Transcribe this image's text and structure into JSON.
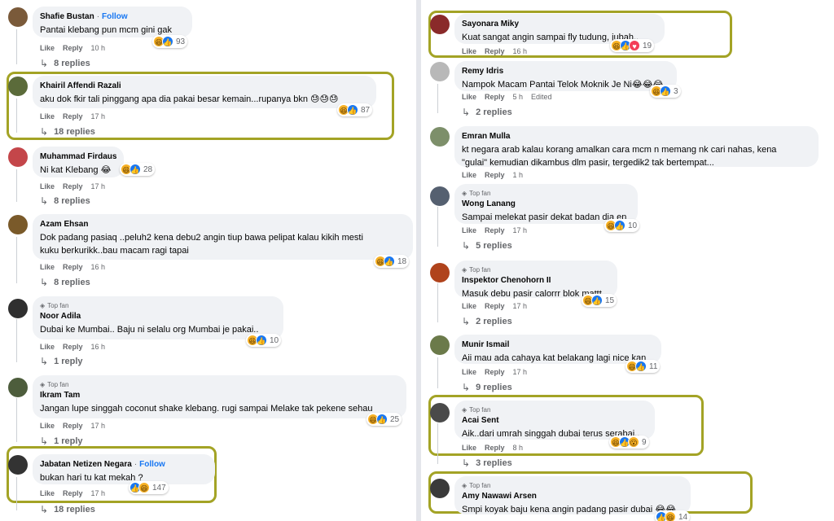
{
  "ui": {
    "like_label": "Like",
    "reply_label": "Reply",
    "top_fan_label": "Top fan",
    "follow_label": "Follow",
    "dot": "·",
    "reply_arrow": "↳",
    "diamond": "◈"
  },
  "highlight_color": "#a3a325",
  "left_comments": [
    {
      "name": "Shafie Bustan",
      "follow": true,
      "text": "Pantai klebang pun mcm gini gak",
      "time": "10 h",
      "reactions": [
        "haha",
        "like"
      ],
      "count": "93",
      "replies": "8 replies"
    },
    {
      "name": "Khairil Affendi Razali",
      "text": "aku dok fkir tali pinggang apa dia pakai besar kemain...rupanya bkn 😓😓😓",
      "time": "17 h",
      "reactions": [
        "haha",
        "like"
      ],
      "count": "87",
      "replies": "18 replies"
    },
    {
      "name": "Muhammad Firdaus",
      "text": "Ni kat Klebang 😂",
      "time": "17 h",
      "reactions": [
        "haha",
        "like"
      ],
      "count": "28",
      "replies": "8 replies"
    },
    {
      "name": "Azam Ehsan",
      "text": "Dok padang pasiaq ..peluh2 kena debu2 angin tiup bawa pelipat kalau kikih mesti",
      "text2": "kuku berkurikk..bau macam ragi tapai",
      "time": "16 h",
      "reactions": [
        "haha",
        "like"
      ],
      "count": "18",
      "replies": "8 replies"
    },
    {
      "name": "Noor Adila",
      "topfan": true,
      "text": "Dubai ke Mumbai.. Baju ni selalu org Mumbai je pakai..",
      "time": "16 h",
      "reactions": [
        "haha",
        "like"
      ],
      "count": "10",
      "replies": "1 reply"
    },
    {
      "name": "Ikram Tam",
      "topfan": true,
      "text": "Jangan lupe singgah coconut shake klebang. rugi sampai Melake tak pekene sehau",
      "time": "17 h",
      "reactions": [
        "haha",
        "like"
      ],
      "count": "25",
      "replies": "1 reply"
    },
    {
      "name": "Jabatan Netizen Negara",
      "follow": true,
      "text": "bukan hari tu kat mekah ?",
      "time": "17 h",
      "reactions": [
        "like",
        "haha"
      ],
      "count": "147",
      "replies": "18 replies"
    }
  ],
  "right_comments": [
    {
      "name": "Sayonara Miky",
      "text": "Kuat sangat angin sampai fly tudung, jubah..",
      "time": "16 h",
      "reactions": [
        "haha",
        "like",
        "love"
      ],
      "count": "19"
    },
    {
      "name": "Remy Idris",
      "text": "Nampok Macam Pantai Telok Moknik Je Ni😂😂😂",
      "time": "5 h",
      "edited": "Edited",
      "reactions": [
        "haha",
        "like"
      ],
      "count": "3",
      "replies": "2 replies"
    },
    {
      "name": "Emran Mulla",
      "text": "kt negara arab kalau korang amalkan cara mcm n memang nk cari nahas, kena",
      "text2": "\"gulai\" kemudian dikambus dlm pasir, tergedik2 tak bertempat...",
      "time": "1 h"
    },
    {
      "name": "Wong Lanang",
      "topfan": true,
      "text": "Sampai melekat pasir dekat badan dia en",
      "time": "17 h",
      "reactions": [
        "haha",
        "like"
      ],
      "count": "10",
      "replies": "5 replies"
    },
    {
      "name": "Inspektor Chenohorn II",
      "topfan": true,
      "text": "Masuk debu pasir calorrr blok mattt",
      "time": "17 h",
      "reactions": [
        "haha",
        "like"
      ],
      "count": "15",
      "replies": "2 replies"
    },
    {
      "name": "Munir Ismail",
      "text": "Aii mau ada cahaya kat belakang lagi nice kan",
      "time": "17 h",
      "reactions": [
        "haha",
        "like"
      ],
      "count": "11",
      "replies": "9 replies"
    },
    {
      "name": "Acai Sent",
      "topfan": true,
      "text": "Aik..dari umrah singgah dubai terus serabai..",
      "time": "8 h",
      "reactions": [
        "haha",
        "like",
        "wow"
      ],
      "count": "9",
      "replies": "3 replies"
    },
    {
      "name": "Amy Nawawi Arsen",
      "topfan": true,
      "text": "Smpi koyak baju kena angin padang pasir dubai 😂😂",
      "reactions": [
        "like",
        "haha"
      ],
      "count": "14"
    }
  ]
}
